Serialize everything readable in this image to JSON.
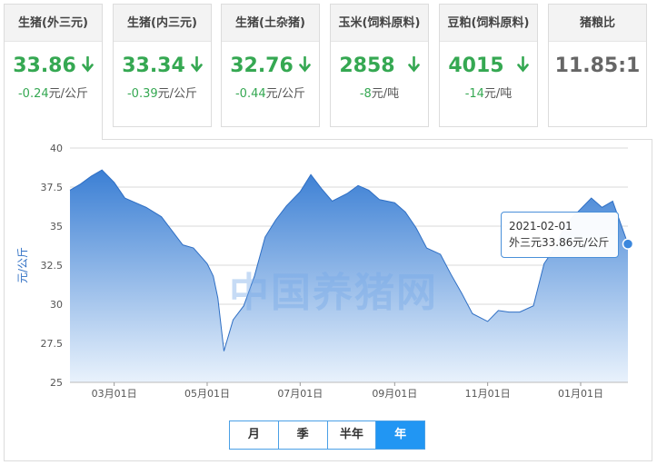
{
  "cards": [
    {
      "title": "生猪(外三元)",
      "price": "33.86",
      "change": "-0.24",
      "unit": "元/公斤",
      "trend": "down"
    },
    {
      "title": "生猪(内三元)",
      "price": "33.34",
      "change": "-0.39",
      "unit": "元/公斤",
      "trend": "down"
    },
    {
      "title": "生猪(土杂猪)",
      "price": "32.76",
      "change": "-0.44",
      "unit": "元/公斤",
      "trend": "down"
    },
    {
      "title": "玉米(饲料原料)",
      "price": "2858",
      "change": "-8",
      "unit": "元/吨",
      "trend": "down"
    },
    {
      "title": "豆粕(饲料原料)",
      "price": "4015",
      "change": "-14",
      "unit": "元/吨",
      "trend": "down"
    },
    {
      "title": "猪粮比",
      "price": "11.85:1",
      "change": "",
      "unit": "",
      "trend": "none"
    }
  ],
  "tooltip": {
    "date": "2021-02-01",
    "text": "外三元33.86元/公斤"
  },
  "tabs": [
    "月",
    "季",
    "半年",
    "年"
  ],
  "active_tab": "年",
  "watermark": "中国养猪网",
  "colors": {
    "accent": "#2196f3",
    "down": "#35a852",
    "area": "#3b7fd4"
  },
  "chart_data": {
    "type": "area",
    "title": "",
    "xlabel": "",
    "ylabel": "元/公斤",
    "ylim": [
      25,
      40
    ],
    "yticks": [
      25,
      27.5,
      30,
      32.5,
      35,
      37.5,
      40
    ],
    "xticks": [
      "03月01日",
      "05月01日",
      "07月01日",
      "09月01日",
      "11月01日",
      "01月01日"
    ],
    "grid": true,
    "series": [
      {
        "name": "外三元",
        "x": [
          "2020-02-01",
          "2020-02-08",
          "2020-02-15",
          "2020-02-22",
          "2020-03-01",
          "2020-03-08",
          "2020-03-15",
          "2020-03-22",
          "2020-04-01",
          "2020-04-08",
          "2020-04-15",
          "2020-04-22",
          "2020-05-01",
          "2020-05-05",
          "2020-05-08",
          "2020-05-12",
          "2020-05-18",
          "2020-05-25",
          "2020-06-01",
          "2020-06-08",
          "2020-06-15",
          "2020-06-22",
          "2020-07-01",
          "2020-07-08",
          "2020-07-15",
          "2020-07-22",
          "2020-08-01",
          "2020-08-08",
          "2020-08-15",
          "2020-08-22",
          "2020-09-01",
          "2020-09-08",
          "2020-09-15",
          "2020-09-22",
          "2020-10-01",
          "2020-10-08",
          "2020-10-15",
          "2020-10-22",
          "2020-11-01",
          "2020-11-08",
          "2020-11-15",
          "2020-11-22",
          "2020-12-01",
          "2020-12-08",
          "2020-12-15",
          "2020-12-22",
          "2021-01-01",
          "2021-01-08",
          "2021-01-15",
          "2021-01-22",
          "2021-02-01"
        ],
        "values": [
          37.3,
          37.7,
          38.2,
          38.6,
          37.8,
          36.8,
          36.5,
          36.2,
          35.6,
          34.7,
          33.8,
          33.6,
          32.6,
          31.8,
          30.4,
          27.0,
          29.0,
          29.9,
          31.8,
          34.3,
          35.4,
          36.3,
          37.2,
          38.3,
          37.4,
          36.6,
          37.1,
          37.6,
          37.3,
          36.7,
          36.5,
          35.9,
          34.9,
          33.6,
          33.2,
          31.9,
          30.7,
          29.4,
          28.9,
          29.6,
          29.5,
          29.5,
          29.9,
          32.6,
          33.6,
          35.1,
          36.1,
          36.8,
          36.2,
          36.6,
          33.86
        ]
      }
    ]
  }
}
